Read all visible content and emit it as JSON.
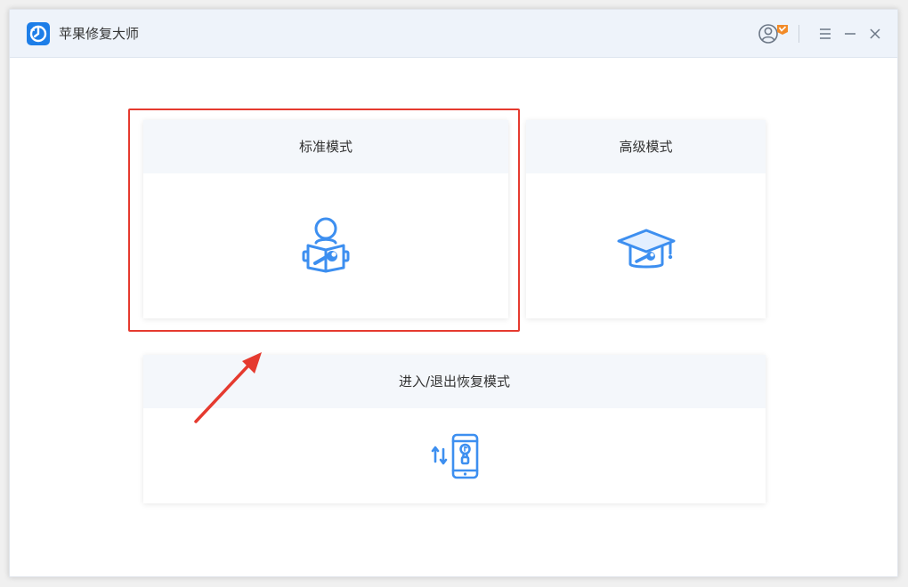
{
  "window": {
    "title": "苹果修复大师"
  },
  "titlebar": {
    "user_icon": "user-vip-icon",
    "menu_icon": "menu-icon",
    "minimize_icon": "minimize-icon",
    "close_icon": "close-icon"
  },
  "modes": {
    "standard": {
      "label": "标准模式",
      "icon": "reader-wrench-icon"
    },
    "advanced": {
      "label": "高级模式",
      "icon": "graduation-cap-icon"
    },
    "recovery": {
      "label": "进入/退出恢复模式",
      "icon": "phone-transfer-icon"
    }
  },
  "colors": {
    "accent": "#3d8ff0",
    "highlight": "#e53a2f",
    "title_bar": "#eef3fa",
    "vip_badge": "#f28a27"
  }
}
